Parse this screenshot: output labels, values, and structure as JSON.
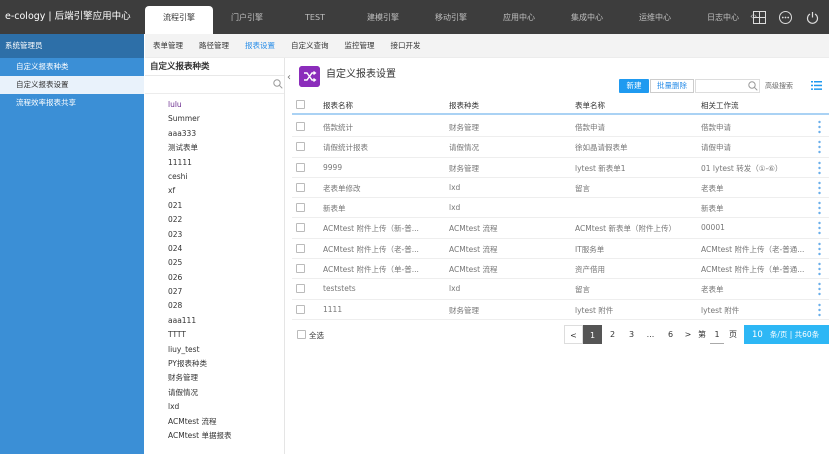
{
  "brand": {
    "title": "e-cology | 后端引擎应用中心"
  },
  "main_tabs": [
    "流程引擎",
    "门户引擎",
    "TEST",
    "建模引擎",
    "移动引擎",
    "应用中心",
    "集成中心",
    "运维中心",
    "日志中心"
  ],
  "top_icons": [
    "grid-icon",
    "more-icon",
    "power-icon"
  ],
  "left_nav": {
    "header": "系统管理员",
    "items": [
      "自定义报表种类",
      "自定义报表设置",
      "流程效率报表共享"
    ],
    "selected_index": 1
  },
  "sub_tabs": [
    "表单管理",
    "路径管理",
    "报表设置",
    "自定义查询",
    "监控管理",
    "接口开发"
  ],
  "sub_tab_active": 2,
  "tree": {
    "title": "自定义报表种类",
    "items": [
      "lulu",
      "Summer",
      "aaa333",
      "测试表单",
      "11111",
      "ceshi",
      "xf",
      "021",
      "022",
      "023",
      "024",
      "025",
      "026",
      "027",
      "028",
      "aaa111",
      "TTTT",
      "liuy_test",
      "PY报表种类",
      "财务管理",
      "请假情况",
      "lxd",
      "ACMtest 流程",
      "ACMtest 单据报表"
    ]
  },
  "content": {
    "title": "自定义报表设置",
    "new_button": "新建",
    "batch_delete_button": "批量删除",
    "advanced_search": "高级搜索",
    "columns": [
      "报表名称",
      "报表种类",
      "表单名称",
      "相关工作流"
    ],
    "rows": [
      [
        "借款统计",
        "财务管理",
        "借款申请",
        "借款申请"
      ],
      [
        "请假统计报表",
        "请假情况",
        "徐如晶请假表单",
        "请假申请"
      ],
      [
        "9999",
        "财务管理",
        "lytest 新表单1",
        "01 lytest 转发（①-⑥）"
      ],
      [
        "老表单修改",
        "lxd",
        "留言",
        "老表单"
      ],
      [
        "新表单",
        "lxd",
        "",
        "新表单"
      ],
      [
        "ACMtest 附件上传（新-普...",
        "ACMtest 流程",
        "ACMtest 新表单（附件上传）",
        "00001"
      ],
      [
        "ACMtest 附件上传（老-普...",
        "ACMtest 流程",
        "IT服务单",
        "ACMtest 附件上传（老-普通..."
      ],
      [
        "ACMtest 附件上传（单-普...",
        "ACMtest 流程",
        "资产借用",
        "ACMtest 附件上传（单-普通..."
      ],
      [
        "teststets",
        "lxd",
        "留言",
        "老表单"
      ],
      [
        "1111",
        "财务管理",
        "lytest 附件",
        "lytest 附件"
      ]
    ],
    "select_all": "全选",
    "pagination": {
      "prev": "<",
      "pages": [
        "1",
        "2",
        "3",
        "...",
        "6"
      ],
      "current": "1",
      "next": ">",
      "goto_prefix": "第",
      "goto_value": "1",
      "goto_suffix": "页",
      "page_size": "10",
      "page_size_suffix": "条/页 | 共60条"
    }
  },
  "colors": {
    "accent": "#1f9af0",
    "sidebar": "#3b8fd6",
    "topbar": "#3d3d3d",
    "icon_purple": "#8b2dbb"
  }
}
